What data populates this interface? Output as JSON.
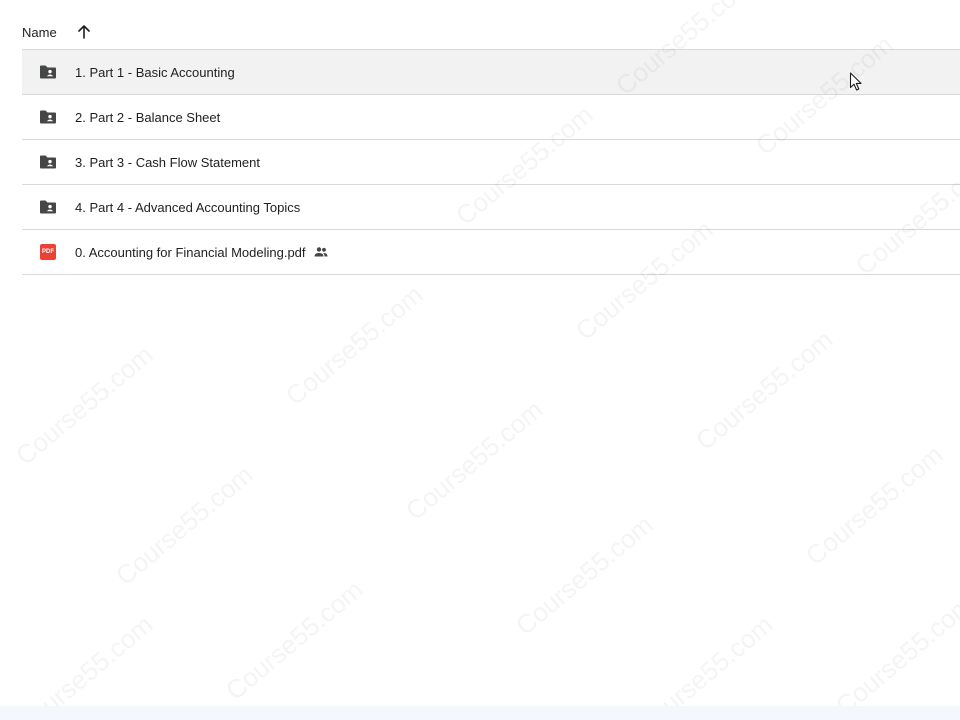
{
  "header": {
    "name_label": "Name",
    "sort_direction": "ascending"
  },
  "rows": [
    {
      "label": "1. Part 1 - Basic Accounting",
      "type": "shared-folder",
      "hovered": true
    },
    {
      "label": "2. Part 2 - Balance Sheet",
      "type": "shared-folder",
      "hovered": false
    },
    {
      "label": "3. Part 3 - Cash Flow Statement",
      "type": "shared-folder",
      "hovered": false
    },
    {
      "label": "4. Part 4 - Advanced Accounting Topics",
      "type": "shared-folder",
      "hovered": false
    },
    {
      "label": "0. Accounting for Financial Modeling.pdf",
      "type": "pdf",
      "badge": "PDF",
      "shared": true,
      "hovered": false
    }
  ],
  "watermark": {
    "text": "Course55.com"
  },
  "colors": {
    "folder_icon": "#444746",
    "pdf_red": "#ea4335",
    "row_hover": "#f2f2f2",
    "divider": "#d9d9d9"
  }
}
